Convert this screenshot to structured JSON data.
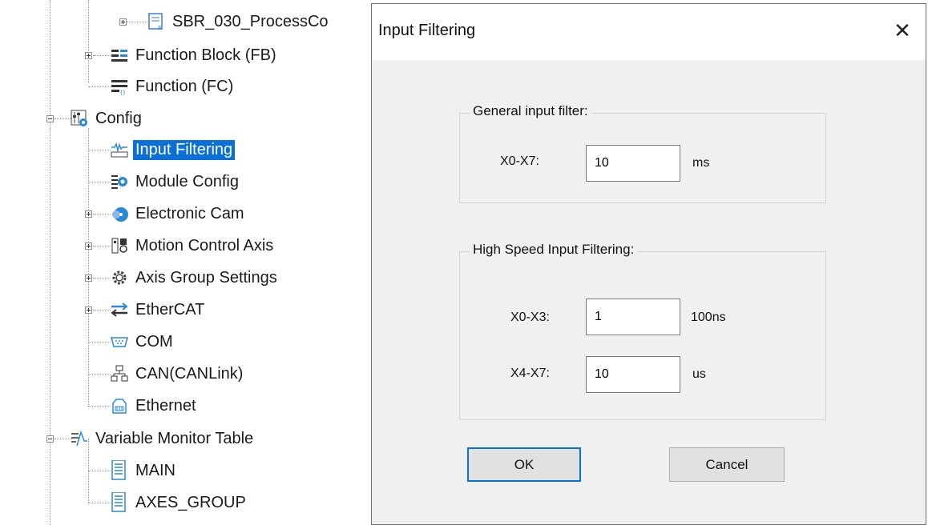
{
  "tree": {
    "items": [
      {
        "label": "SBR_030_ProcessCo",
        "icon": "subroutine-icon"
      },
      {
        "label": "Function Block (FB)",
        "icon": "function-block-icon"
      },
      {
        "label": "Function (FC)",
        "icon": "function-icon"
      },
      {
        "label": "Config",
        "icon": "config-icon"
      },
      {
        "label": "Input Filtering",
        "icon": "input-filtering-icon",
        "selected": true
      },
      {
        "label": "Module Config",
        "icon": "module-config-icon"
      },
      {
        "label": "Electronic Cam",
        "icon": "electronic-cam-icon"
      },
      {
        "label": "Motion Control Axis",
        "icon": "motion-axis-icon"
      },
      {
        "label": "Axis Group Settings",
        "icon": "gear-icon"
      },
      {
        "label": "EtherCAT",
        "icon": "ethercat-icon"
      },
      {
        "label": "COM",
        "icon": "serial-port-icon"
      },
      {
        "label": "CAN(CANLink)",
        "icon": "network-icon"
      },
      {
        "label": "Ethernet",
        "icon": "ethernet-icon"
      },
      {
        "label": "Variable Monitor Table",
        "icon": "monitor-table-icon"
      },
      {
        "label": "MAIN",
        "icon": "table-icon"
      },
      {
        "label": "AXES_GROUP",
        "icon": "table-icon"
      }
    ]
  },
  "dialog": {
    "title": "Input Filtering",
    "close_glyph": "✕",
    "general": {
      "legend": "General input filter:",
      "rows": [
        {
          "label": "X0-X7:",
          "value": "10",
          "unit": "ms"
        }
      ]
    },
    "high_speed": {
      "legend": "High Speed Input Filtering:",
      "rows": [
        {
          "label": "X0-X3:",
          "value": "1",
          "unit": "100ns"
        },
        {
          "label": "X4-X7:",
          "value": "10",
          "unit": "us"
        }
      ]
    },
    "ok_label": "OK",
    "cancel_label": "Cancel"
  },
  "colors": {
    "selection": "#0b6fd8",
    "dialog_bg": "#f0f0f0"
  }
}
